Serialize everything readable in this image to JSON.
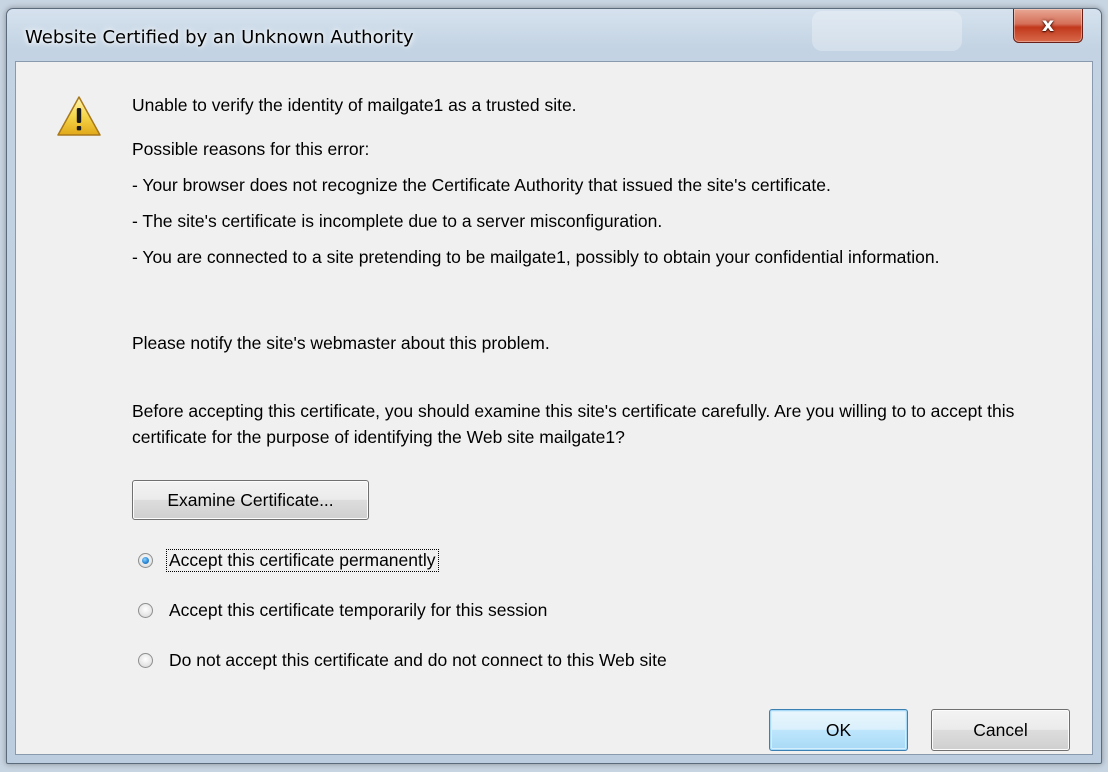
{
  "window": {
    "title": "Website Certified by an Unknown Authority",
    "close_glyph": "x",
    "close_icon": "close-icon"
  },
  "message": {
    "icon": "warning-icon",
    "headline": "Unable to verify the identity of mailgate1 as a trusted site.",
    "reasons_heading": "Possible reasons for this error:",
    "reasons": [
      "- Your browser does not recognize the Certificate Authority that issued the site's certificate.",
      "- The site's certificate is incomplete due to a server misconfiguration.",
      "- You are connected to a site pretending to be mailgate1, possibly to obtain your confidential information."
    ],
    "notify": "Please notify the site's webmaster about this problem.",
    "question": "Before accepting this certificate, you should examine this site's certificate carefully. Are you willing to to accept this certificate for the purpose of identifying the Web site mailgate1?"
  },
  "examine_button": {
    "label": "Examine Certificate..."
  },
  "options": [
    {
      "label": "Accept this certificate permanently",
      "checked": true
    },
    {
      "label": "Accept this certificate temporarily for this session",
      "checked": false
    },
    {
      "label": "Do not accept this certificate and do not connect to this Web site",
      "checked": false
    }
  ],
  "buttons": {
    "ok": "OK",
    "cancel": "Cancel"
  },
  "colors": {
    "warning_yellow": "#f6d64a",
    "close_red": "#c1381c",
    "default_button_border": "#3c7fb1",
    "radio_dot": "#2a8ad8"
  }
}
